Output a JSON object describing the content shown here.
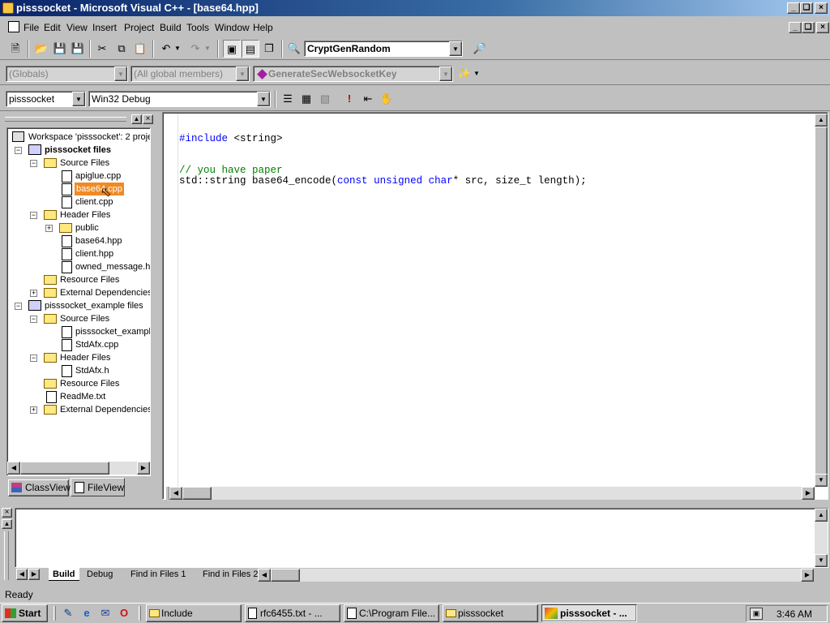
{
  "window": {
    "title": "pisssocket - Microsoft Visual C++ - [base64.hpp]"
  },
  "menu": {
    "items": [
      {
        "label": "File"
      },
      {
        "label": "Edit"
      },
      {
        "label": "View"
      },
      {
        "label": "Insert"
      },
      {
        "label": "Project"
      },
      {
        "label": "Build"
      },
      {
        "label": "Tools"
      },
      {
        "label": "Window"
      },
      {
        "label": "Help"
      }
    ]
  },
  "toolbar": {
    "find_combo": "CryptGenRandom"
  },
  "wizardbar": {
    "class_combo": "(Globals)",
    "filter_combo": "(All global members)",
    "members_combo": "GenerateSecWebsocketKey"
  },
  "buildbar": {
    "project_combo": "pisssocket",
    "config_combo": "Win32 Debug"
  },
  "workspace": {
    "tree": [
      {
        "label": "Workspace 'pisssocket': 2 proje",
        "icon": "workspace-icon"
      },
      {
        "label": "pisssocket files",
        "icon": "project-icon",
        "bold": true
      },
      {
        "label": "Source Files",
        "icon": "folder-icon"
      },
      {
        "label": "apiglue.cpp",
        "icon": "file-icon"
      },
      {
        "label": "base64.cpp",
        "icon": "file-icon",
        "selected": true
      },
      {
        "label": "client.cpp",
        "icon": "file-icon"
      },
      {
        "label": "Header Files",
        "icon": "folder-icon"
      },
      {
        "label": "public",
        "icon": "folder-icon"
      },
      {
        "label": "base64.hpp",
        "icon": "file-icon"
      },
      {
        "label": "client.hpp",
        "icon": "file-icon"
      },
      {
        "label": "owned_message.h",
        "icon": "file-icon"
      },
      {
        "label": "Resource Files",
        "icon": "folder-icon"
      },
      {
        "label": "External Dependencies",
        "icon": "folder-icon"
      },
      {
        "label": "pisssocket_example files",
        "icon": "project-icon"
      },
      {
        "label": "Source Files",
        "icon": "folder-icon"
      },
      {
        "label": "pisssocket_exampl",
        "icon": "file-icon"
      },
      {
        "label": "StdAfx.cpp",
        "icon": "file-icon"
      },
      {
        "label": "Header Files",
        "icon": "folder-icon"
      },
      {
        "label": "StdAfx.h",
        "icon": "file-icon"
      },
      {
        "label": "Resource Files",
        "icon": "folder-icon"
      },
      {
        "label": "ReadMe.txt",
        "icon": "file-icon"
      },
      {
        "label": "External Dependencies",
        "icon": "folder-icon"
      }
    ],
    "tabs": [
      {
        "label": "ClassView"
      },
      {
        "label": "FileView"
      }
    ]
  },
  "editor": {
    "line1_kw": "#include",
    "line1_rest": " <string>",
    "line2_comment": "// you have paper",
    "line3_a": "std::string base64_encode(",
    "line3_kw1": "const",
    "line3_sp1": " ",
    "line3_kw2": "unsigned",
    "line3_sp2": " ",
    "line3_kw3": "char",
    "line3_b": "* src, size_t length);"
  },
  "output": {
    "tabs": [
      {
        "label": "Build"
      },
      {
        "label": "Debug"
      },
      {
        "label": "Find in Files 1"
      },
      {
        "label": "Find in Files 2"
      }
    ]
  },
  "status": {
    "text": "Ready"
  },
  "taskbar": {
    "start_label": "Start",
    "tasks": [
      {
        "label": "Include"
      },
      {
        "label": "rfc6455.txt - ..."
      },
      {
        "label": "C:\\Program File..."
      },
      {
        "label": "pisssocket"
      },
      {
        "label": "pisssocket - ..."
      }
    ],
    "clock": "3:46 AM"
  }
}
